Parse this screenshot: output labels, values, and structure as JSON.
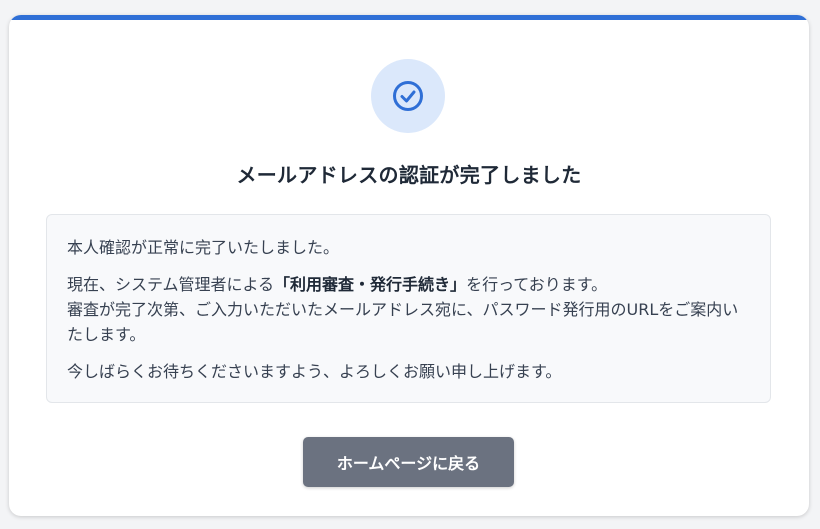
{
  "header": {
    "title": "メールアドレスの認証が完了しました"
  },
  "status_icon": {
    "name": "check-circle-icon",
    "color": "#2f6fd6",
    "background": "#dbe8fb"
  },
  "message": {
    "line1": "本人確認が正常に完了いたしました。",
    "line2_before": "現在、システム管理者による",
    "line2_emphasis": "「利用審査・発行手続き」",
    "line2_after": "を行っております。",
    "line3": "審査が完了次第、ご入力いただいたメールアドレス宛に、パスワード発行用のURLをご案内いたします。",
    "line4": "今しばらくお待ちくださいますよう、よろしくお願い申し上げます。"
  },
  "actions": {
    "home_label": "ホームページに戻る"
  },
  "colors": {
    "accent": "#2f6fd6",
    "button": "#6b7280"
  }
}
